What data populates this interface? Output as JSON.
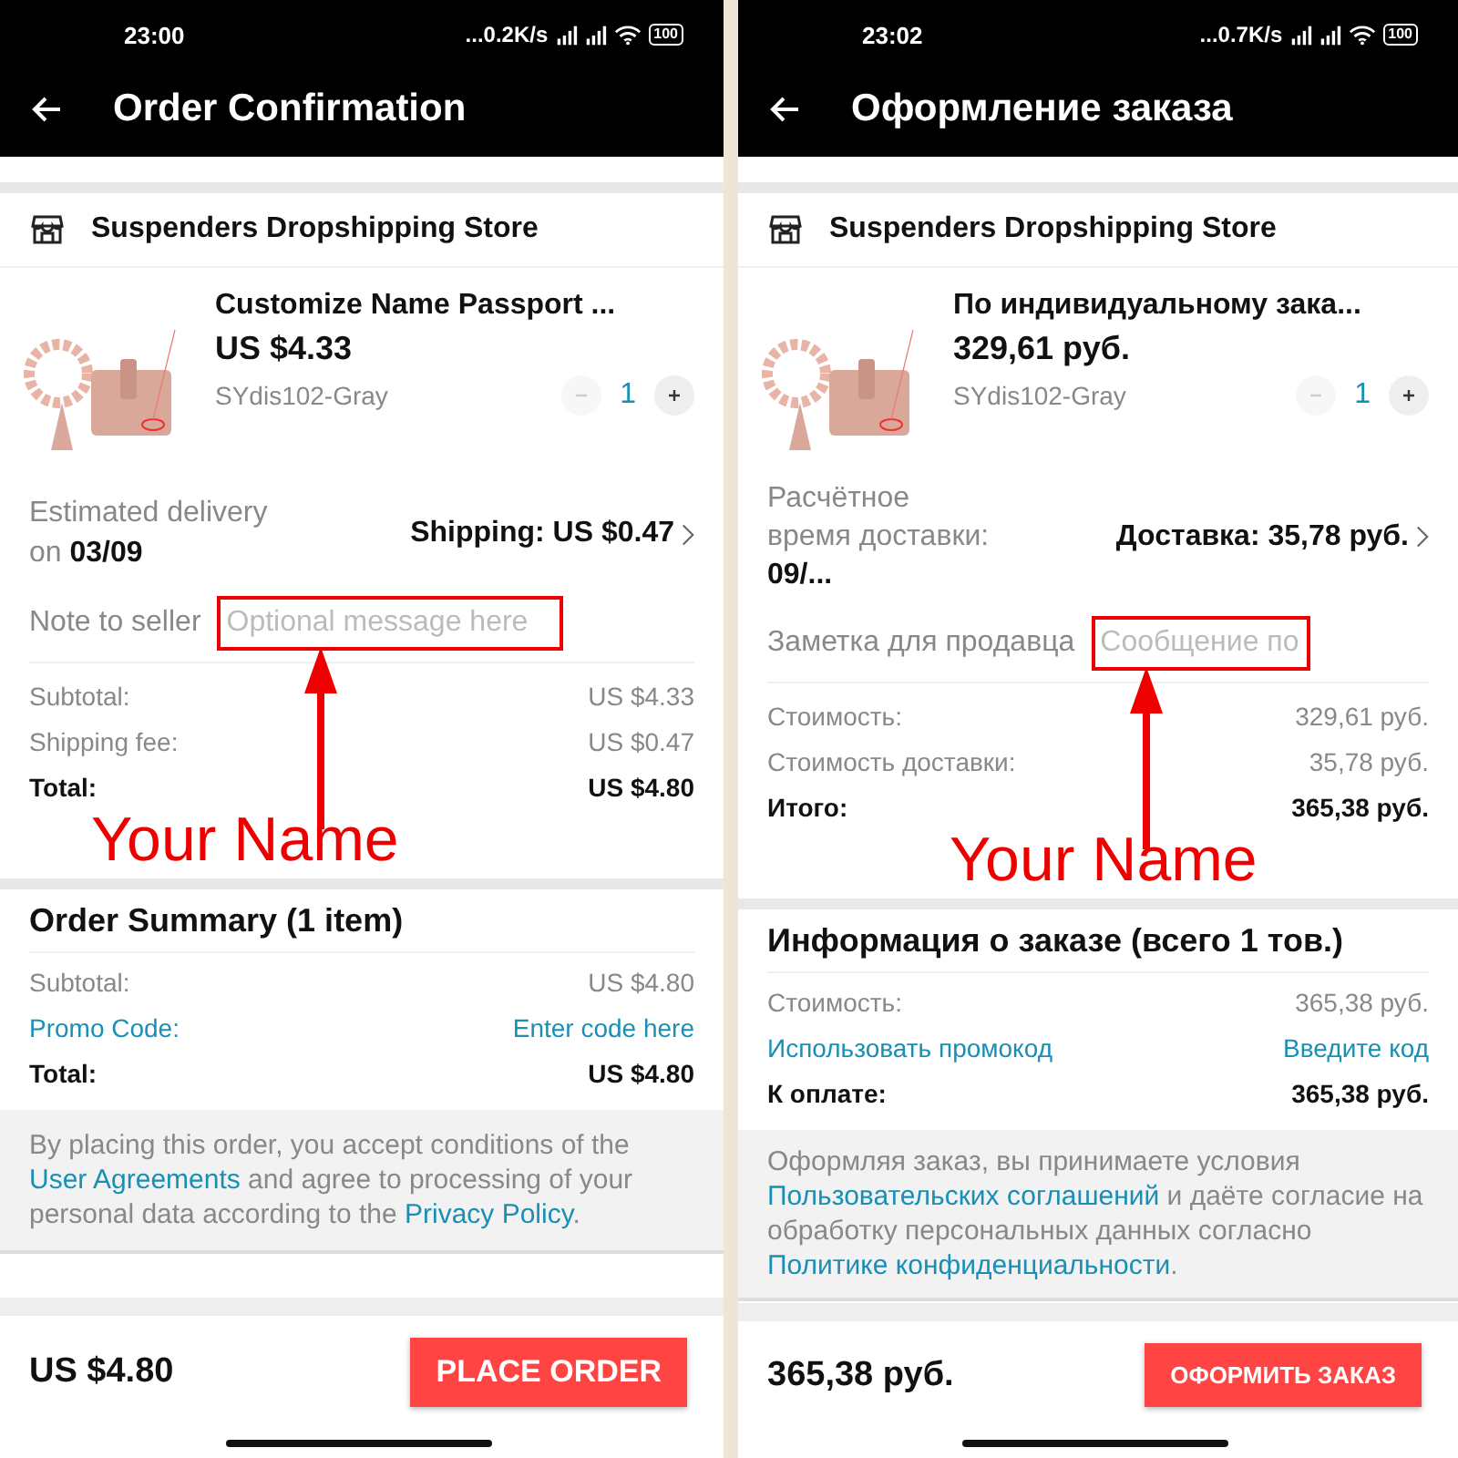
{
  "screens": [
    {
      "status_bar": {
        "time": "23:00",
        "speed": "...0.2K/s",
        "battery": "100"
      },
      "title": "Order Confirmation",
      "store": "Suspenders Dropshipping Store",
      "product": {
        "title": "Customize Name Passport ...",
        "price": "US $4.33",
        "sku": "SYdis102-Gray",
        "quantity": "1",
        "decrement_disabled": true
      },
      "delivery": {
        "label": "Estimated delivery on",
        "date": "03/09",
        "shipping": "Shipping: US $0.47"
      },
      "note": {
        "label": "Note to seller",
        "placeholder": "Optional message here"
      },
      "costs": [
        {
          "label": "Subtotal:",
          "value": "US $4.33",
          "kind": "normal"
        },
        {
          "label": "Shipping fee:",
          "value": "US $0.47",
          "kind": "normal"
        },
        {
          "label": "Total:",
          "value": "US $4.80",
          "kind": "total"
        }
      ],
      "annotation": "Your Name",
      "summary": {
        "title": "Order Summary (1 item)",
        "rows": [
          {
            "label": "Subtotal:",
            "value": "US $4.80",
            "kind": "normal"
          },
          {
            "label": "Promo Code:",
            "value": "Enter code here",
            "kind": "link"
          },
          {
            "label": "Total:",
            "value": "US $4.80",
            "kind": "total"
          }
        ]
      },
      "legal": [
        {
          "text": "By placing this order, you accept conditions of the ",
          "kind": "text"
        },
        {
          "text": "User Agreements",
          "kind": "link"
        },
        {
          "text": " and agree to processing of your personal data according to the ",
          "kind": "text"
        },
        {
          "text": "Privacy Policy",
          "kind": "link"
        },
        {
          "text": ".",
          "kind": "text"
        }
      ],
      "footer": {
        "total": "US $4.80",
        "button": "PLACE ORDER"
      }
    },
    {
      "status_bar": {
        "time": "23:02",
        "speed": "...0.7K/s",
        "battery": "100"
      },
      "title": "Оформление заказа",
      "store": "Suspenders Dropshipping Store",
      "product": {
        "title": "По индивидуальному зака...",
        "price": "329,61 руб.",
        "sku": "SYdis102-Gray",
        "quantity": "1",
        "decrement_disabled": true
      },
      "delivery": {
        "label": "Расчётное время доставки:",
        "date": "09/...",
        "shipping": "Доставка: 35,78 руб."
      },
      "note": {
        "label": "Заметка для продавца",
        "placeholder": "Сообщение по"
      },
      "costs": [
        {
          "label": "Стоимость:",
          "value": "329,61 руб.",
          "kind": "normal"
        },
        {
          "label": "Стоимость доставки:",
          "value": "35,78 руб.",
          "kind": "normal"
        },
        {
          "label": "Итого:",
          "value": "365,38 руб.",
          "kind": "total"
        }
      ],
      "annotation": "Your Name",
      "summary": {
        "title": "Информация о заказе (всего 1 тов.)",
        "rows": [
          {
            "label": "Стоимость:",
            "value": "365,38 руб.",
            "kind": "normal"
          },
          {
            "label": "Использовать промокод",
            "value": "Введите код",
            "kind": "link"
          },
          {
            "label": "К оплате:",
            "value": "365,38 руб.",
            "kind": "total"
          }
        ]
      },
      "legal": [
        {
          "text": "Оформляя заказ, вы принимаете условия ",
          "kind": "text"
        },
        {
          "text": "Пользовательских соглашений",
          "kind": "link"
        },
        {
          "text": " и даёте согласие на обработку персональных данных согласно ",
          "kind": "text"
        },
        {
          "text": "Политике конфиденциальности",
          "kind": "link"
        },
        {
          "text": ".",
          "kind": "text"
        }
      ],
      "footer": {
        "total": "365,38 руб.",
        "button": "ОФОРМИТЬ ЗАКАЗ"
      }
    }
  ]
}
